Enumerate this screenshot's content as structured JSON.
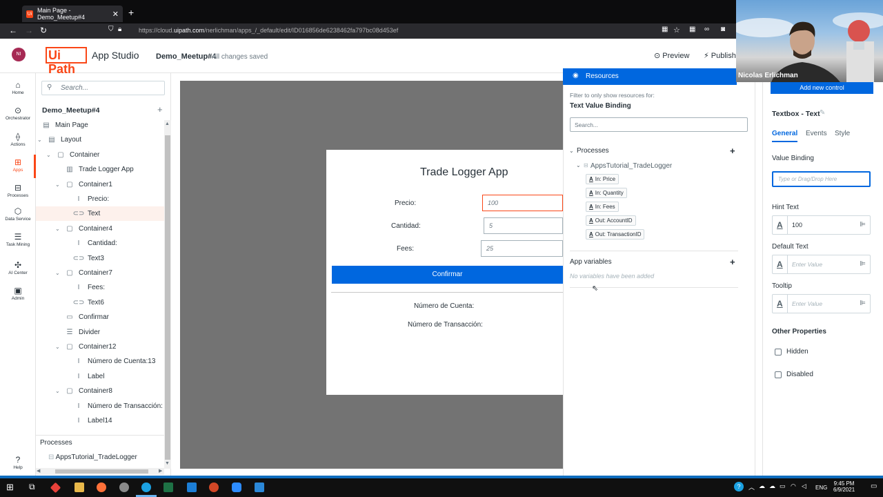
{
  "browser": {
    "tab_title": "Main Page - Demo_Meetup#4",
    "tab_close": "✕",
    "new_tab": "+",
    "url_prefix": "https://cloud.",
    "url_domain": "uipath.com",
    "url_rest": "/nerlichman/apps_/_default/edit/ID016856de6238462fa797bc08d453ef"
  },
  "header": {
    "avatar": "NI",
    "logo": "Ui Path",
    "product": "App Studio",
    "project": "Demo_Meetup#4",
    "save_status": "All changes saved",
    "preview": "Preview",
    "publish": "Publish"
  },
  "left_nav": [
    {
      "label": "Home",
      "icon": "⌂"
    },
    {
      "label": "Orchestrator",
      "icon": "⊙"
    },
    {
      "label": "Actions",
      "icon": "⟠"
    },
    {
      "label": "Apps",
      "icon": "⊞"
    },
    {
      "label": "Processes",
      "icon": "⊟"
    },
    {
      "label": "Data Service",
      "icon": "⬡"
    },
    {
      "label": "Task Mining",
      "icon": "☰"
    },
    {
      "label": "AI Center",
      "icon": "✣"
    },
    {
      "label": "Admin",
      "icon": "▣"
    },
    {
      "label": "Help",
      "icon": "?"
    }
  ],
  "tree": {
    "search_placeholder": "Search...",
    "title": "Demo_Meetup#4",
    "rows": [
      {
        "label": "Main Page",
        "icon": "▤",
        "toggle": ""
      },
      {
        "label": "Layout",
        "icon": "▤",
        "toggle": "⌄"
      },
      {
        "label": "Container",
        "icon": "▢",
        "toggle": "⌄"
      },
      {
        "label": "Trade Logger App",
        "icon": "▥",
        "toggle": ""
      },
      {
        "label": "Container1",
        "icon": "▢",
        "toggle": "⌄"
      },
      {
        "label": "Precio:",
        "icon": "I",
        "toggle": ""
      },
      {
        "label": "Text",
        "icon": "⊂⊃",
        "toggle": ""
      },
      {
        "label": "Container4",
        "icon": "▢",
        "toggle": "⌄"
      },
      {
        "label": "Cantidad:",
        "icon": "I",
        "toggle": ""
      },
      {
        "label": "Text3",
        "icon": "⊂⊃",
        "toggle": ""
      },
      {
        "label": "Container7",
        "icon": "▢",
        "toggle": "⌄"
      },
      {
        "label": "Fees:",
        "icon": "I",
        "toggle": ""
      },
      {
        "label": "Text6",
        "icon": "⊂⊃",
        "toggle": ""
      },
      {
        "label": "Confirmar",
        "icon": "▭",
        "toggle": ""
      },
      {
        "label": "Divider",
        "icon": "☰",
        "toggle": ""
      },
      {
        "label": "Container12",
        "icon": "▢",
        "toggle": "⌄"
      },
      {
        "label": "Número de Cuenta:13",
        "icon": "I",
        "toggle": ""
      },
      {
        "label": "Label",
        "icon": "I",
        "toggle": ""
      },
      {
        "label": "Container8",
        "icon": "▢",
        "toggle": "⌄"
      },
      {
        "label": "Número de Transacción:",
        "icon": "I",
        "toggle": ""
      },
      {
        "label": "Label14",
        "icon": "I",
        "toggle": ""
      }
    ],
    "processes_label": "Processes",
    "process_item": "AppsTutorial_TradeLogger"
  },
  "form": {
    "title": "Trade Logger App",
    "precio_label": "Precio:",
    "precio_value": "100",
    "cantidad_label": "Cantidad:",
    "cantidad_value": "5",
    "fees_label": "Fees:",
    "fees_value": "25",
    "confirm": "Confirmar",
    "cuenta_label": "Número de Cuenta:",
    "transaccion_label": "Número de Transacción:"
  },
  "resources": {
    "title": "Resources",
    "filter_text": "Filter to only show resources for:",
    "filter_target": "Text Value Binding",
    "search_placeholder": "Search...",
    "processes": "Processes",
    "process_name": "AppsTutorial_TradeLogger",
    "args": [
      "In: Price",
      "In: Quantity",
      "In: Fees",
      "Out: AccountID",
      "Out: TransactionID"
    ],
    "app_variables": "App variables",
    "empty": "No variables have been added"
  },
  "properties": {
    "add_control": "Add new control",
    "title": "Textbox - Text",
    "tabs": [
      "General",
      "Events",
      "Style"
    ],
    "value_binding": "Value Binding",
    "value_binding_placeholder": "Type or Drag/Drop Here",
    "hint_text": "Hint Text",
    "hint_value": "100",
    "default_text": "Default Text",
    "default_placeholder": "Enter Value",
    "tooltip": "Tooltip",
    "tooltip_placeholder": "Enter Value",
    "other_properties": "Other Properties",
    "hidden": "Hidden",
    "disabled": "Disabled"
  },
  "webcam": {
    "name": "Nicolas Erlichman"
  },
  "taskbar": {
    "lang": "ENG",
    "time": "9:45 PM",
    "date": "6/9/2021"
  },
  "colors": {
    "brand": "#fa4616",
    "primary": "#0067df"
  }
}
